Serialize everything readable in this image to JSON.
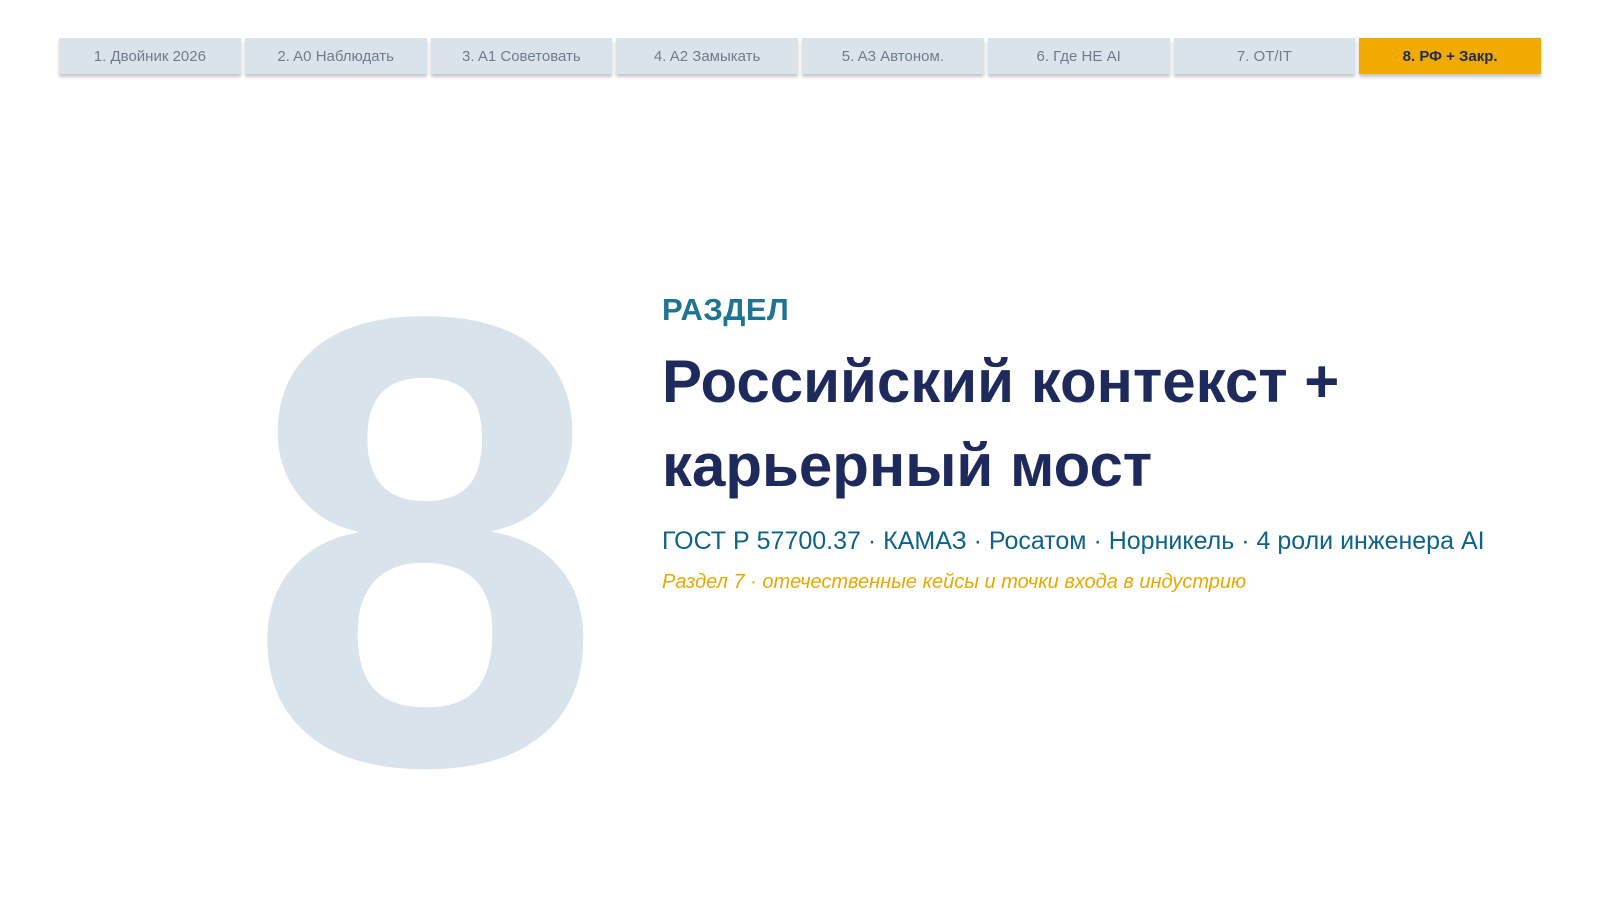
{
  "nav": {
    "tabs": [
      {
        "label": "1. Двойник 2026",
        "active": false
      },
      {
        "label": "2. A0 Наблюдать",
        "active": false
      },
      {
        "label": "3. A1 Советовать",
        "active": false
      },
      {
        "label": "4. A2 Замыкать",
        "active": false
      },
      {
        "label": "5. A3 Автоном.",
        "active": false
      },
      {
        "label": "6. Где НЕ AI",
        "active": false
      },
      {
        "label": "7. OT/IT",
        "active": false
      },
      {
        "label": "8. РФ + Закр.",
        "active": true
      }
    ]
  },
  "section": {
    "number": "8",
    "eyebrow": "РАЗДЕЛ",
    "title_line1": "Российский контекст +",
    "title_line2": "карьерный мост",
    "subtitle": "ГОСТ Р 57700.37 · КАМАЗ · Росатом · Норникель · 4 роли инженера AI",
    "note": "Раздел 7 · отечественные кейсы и точки входа в индустрию"
  },
  "colors": {
    "tab_bg": "#dae3ea",
    "tab_active_bg": "#f0aa00",
    "big_number": "#d9e3eb",
    "eyebrow": "#1f7493",
    "title": "#1f2a5c",
    "subtitle": "#0f6387",
    "note": "#e8a800"
  }
}
